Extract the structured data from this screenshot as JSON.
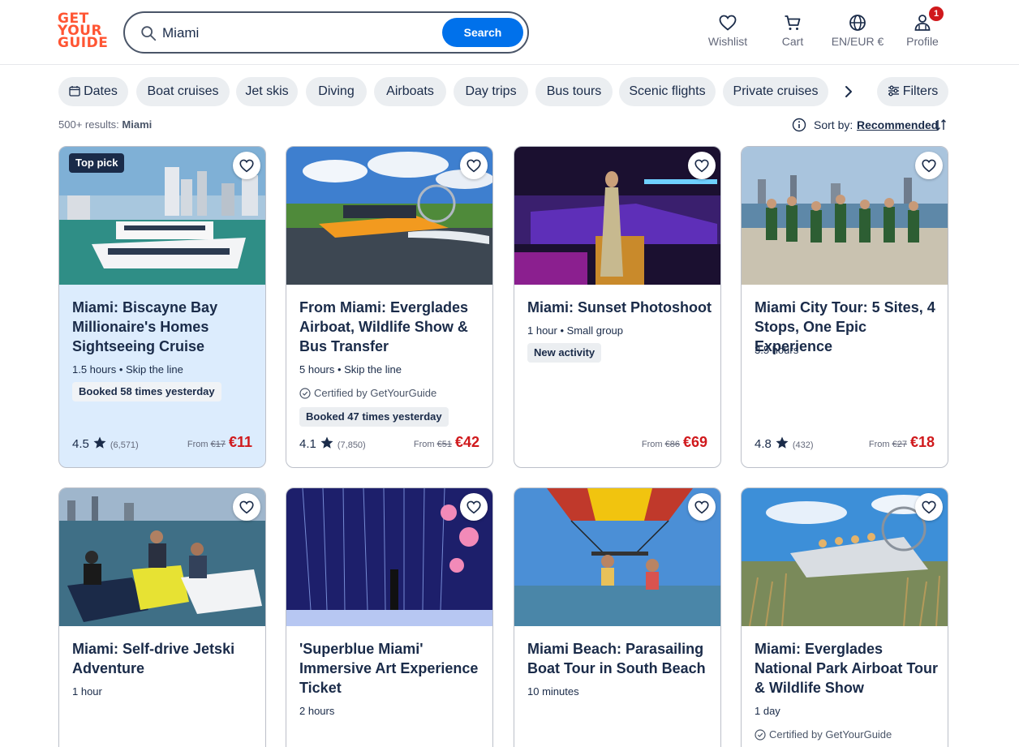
{
  "header": {
    "logo_lines": [
      "GET",
      "YOUR",
      "GUIDE"
    ],
    "search": {
      "value": "Miami",
      "button_label": "Search"
    },
    "nav": {
      "wishlist": "Wishlist",
      "cart": "Cart",
      "locale": "EN/EUR €",
      "profile": "Profile",
      "profile_badge": "1"
    }
  },
  "filters": {
    "chips": [
      "Dates",
      "Boat cruises",
      "Jet skis",
      "Diving",
      "Airboats",
      "Day trips",
      "Bus tours",
      "Scenic flights",
      "Private cruises"
    ],
    "filters_label": "Filters"
  },
  "results": {
    "count_label": "500+ results:",
    "query": "Miami"
  },
  "sort": {
    "label": "Sort by:",
    "value": "Recommended"
  },
  "cards": [
    {
      "badge": "Top pick",
      "title": "Miami: Biscayne Bay Millionaire's Homes Sightseeing Cruise",
      "meta": "1.5 hours • Skip the line",
      "pill": "Booked 58 times yesterday",
      "rating": "4.5",
      "reviews": "(6,571)",
      "from_label": "From",
      "old_price": "€17",
      "price": "€11"
    },
    {
      "title": "From Miami: Everglades Airboat, Wildlife Show & Bus Transfer",
      "meta": "5 hours • Skip the line",
      "certified": "Certified by GetYourGuide",
      "pill": "Booked 47 times yesterday",
      "rating": "4.1",
      "reviews": "(7,850)",
      "from_label": "From",
      "old_price": "€51",
      "price": "€42"
    },
    {
      "title": "Miami: Sunset Photoshoot",
      "meta": "1 hour • Small group",
      "pill": "New activity",
      "from_label": "From",
      "old_price": "€86",
      "price": "€69"
    },
    {
      "title": "Miami City Tour: 5 Sites, 4 Stops, One Epic Experience",
      "meta": "3.5 hours",
      "rating": "4.8",
      "reviews": "(432)",
      "from_label": "From",
      "old_price": "€27",
      "price": "€18"
    },
    {
      "title": "Miami: Self-drive Jetski Adventure",
      "meta": "1 hour"
    },
    {
      "title": "'Superblue Miami' Immersive Art Experience Ticket",
      "meta": "2 hours"
    },
    {
      "title": "Miami Beach: Parasailing Boat Tour in South Beach",
      "meta": "10 minutes"
    },
    {
      "title": "Miami: Everglades National Park Airboat Tour & Wildlife Show",
      "meta": "1 day",
      "certified": "Certified by GetYourGuide"
    }
  ]
}
